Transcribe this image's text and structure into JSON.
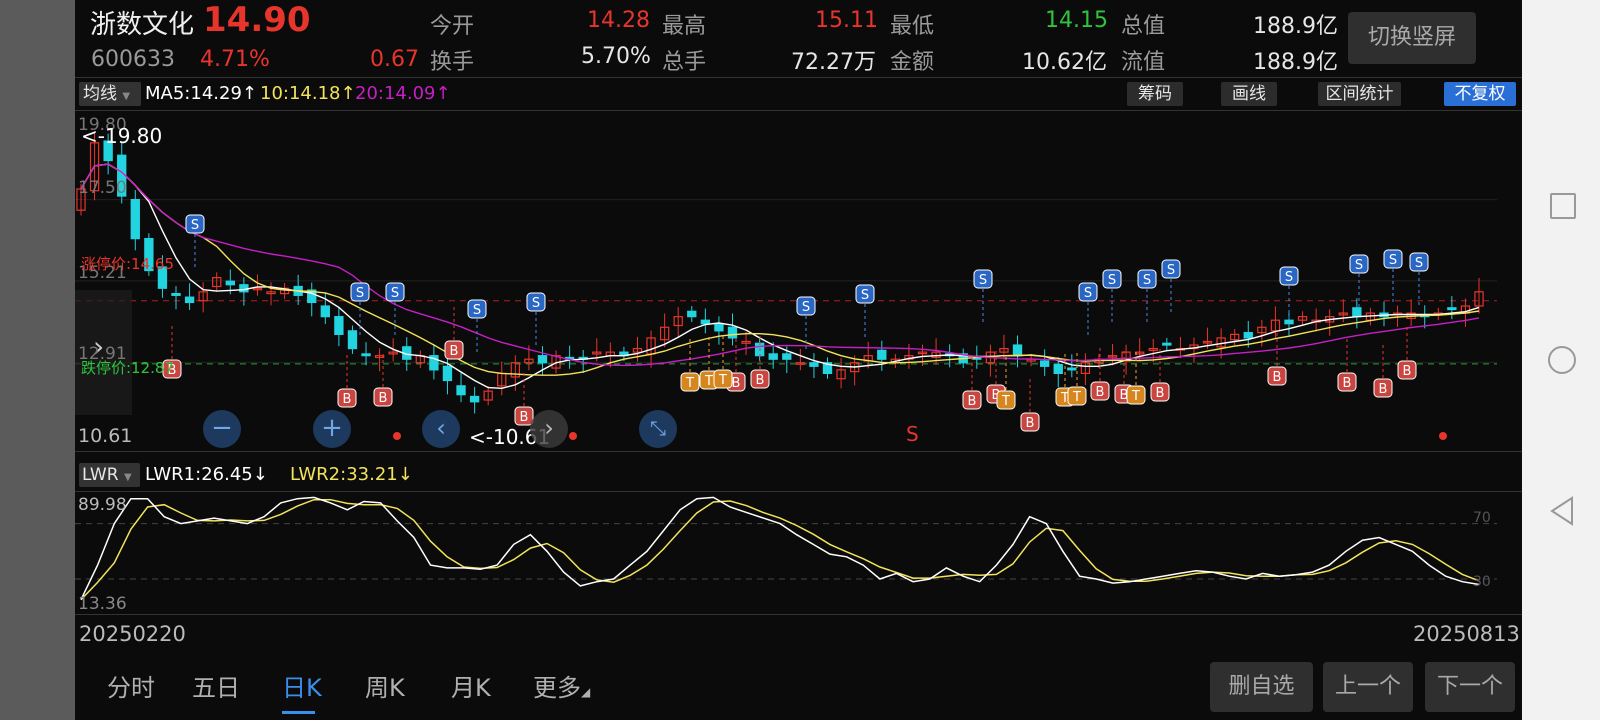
{
  "stock": {
    "name": "浙数文化",
    "price": "14.90",
    "code": "600633",
    "change_pct": "4.71%",
    "change_amt": "0.67"
  },
  "quote": {
    "open_label": "今开",
    "open": "14.28",
    "high_label": "最高",
    "high": "15.11",
    "low_label": "最低",
    "low": "14.15",
    "total_mv_label": "总值",
    "total_mv": "188.9亿",
    "turnover_label": "换手",
    "turnover": "5.70%",
    "volume_label": "总手",
    "volume": "72.27万",
    "amount_label": "金额",
    "amount": "10.62亿",
    "float_mv_label": "流值",
    "float_mv": "188.9亿"
  },
  "switch_button": "切换竖屏",
  "ma_bar": {
    "selector": "均线",
    "ma5": "MA5:14.29↑",
    "ma10": "10:14.18↑",
    "ma20": "20:14.09↑"
  },
  "tools": {
    "chips": "筹码",
    "draw": "画线",
    "range": "区间统计",
    "adjust": "不复权"
  },
  "price_axis": {
    "top": "19.80",
    "l2": "17.50",
    "l3": "15.21",
    "l4": "12.91",
    "bottom": "10.61"
  },
  "annotations": {
    "high_mark": "<-19.80",
    "low_mark": "<-10.61",
    "limit_up": "涨停价:14.65",
    "limit_down": "跌停价:12.87",
    "s_mark": "S"
  },
  "lwr_bar": {
    "selector": "LWR",
    "lwr1": "LWR1:26.45↓",
    "lwr2": "LWR2:33.21↓"
  },
  "lwr_axis": {
    "top": "89.98",
    "bottom": "13.36",
    "r70": "70",
    "r30": "30"
  },
  "dates": {
    "start": "20250220",
    "end": "20250813"
  },
  "tabs": [
    "分时",
    "五日",
    "日K",
    "周K",
    "月K",
    "更多"
  ],
  "active_tab": 2,
  "actions": {
    "remove": "删自选",
    "prev": "上一个",
    "next": "下一个"
  },
  "colors": {
    "up": "#e8352c",
    "down": "#22d3e0",
    "ma5": "#ffffff",
    "ma10": "#f2e35a",
    "ma20": "#c51fc5",
    "active_tab": "#3b8eea"
  },
  "chart_data": {
    "type": "candlestick",
    "ylim": [
      10.61,
      19.8
    ],
    "x_range": [
      "20250220",
      "20250813"
    ],
    "lwr_ylim": [
      13.36,
      89.98
    ],
    "closes": [
      17.8,
      19.1,
      18.6,
      17.6,
      16.4,
      15.5,
      15.0,
      14.8,
      14.6,
      14.9,
      15.3,
      15.1,
      14.9,
      15.0,
      14.9,
      15.0,
      14.8,
      14.6,
      14.2,
      13.7,
      13.3,
      13.1,
      13.1,
      13.2,
      13.0,
      13.1,
      12.7,
      12.4,
      12.0,
      11.8,
      12.1,
      12.6,
      12.9,
      13.0,
      12.9,
      13.1,
      13.0,
      13.0,
      13.2,
      13.2,
      13.1,
      13.3,
      13.6,
      13.9,
      14.2,
      14.2,
      14.0,
      13.8,
      13.6,
      13.5,
      13.1,
      13.0,
      13.0,
      12.9,
      12.8,
      12.6,
      12.7,
      12.9,
      13.1,
      13.0,
      13.0,
      13.1,
      13.2,
      13.2,
      13.1,
      12.9,
      13.0,
      13.2,
      13.3,
      13.1,
      13.0,
      12.8,
      12.6,
      12.7,
      12.9,
      13.0,
      13.1,
      13.2,
      13.2,
      13.3,
      13.4,
      13.3,
      13.4,
      13.5,
      13.6,
      13.7,
      13.6,
      13.9,
      14.1,
      14.0,
      14.2,
      14.1,
      14.2,
      14.3,
      14.2,
      14.3,
      14.2,
      14.3,
      14.3,
      14.2,
      14.3,
      14.4,
      14.5,
      14.9
    ],
    "lwr1": [
      15,
      40,
      70,
      88,
      88,
      75,
      70,
      72,
      74,
      72,
      70,
      75,
      85,
      88,
      89,
      85,
      80,
      86,
      85,
      72,
      60,
      40,
      38,
      38,
      37,
      40,
      55,
      62,
      50,
      35,
      25,
      28,
      30,
      40,
      50,
      65,
      80,
      88,
      89,
      82,
      78,
      74,
      70,
      62,
      55,
      48,
      46,
      40,
      30,
      34,
      28,
      30,
      38,
      32,
      28,
      40,
      55,
      75,
      70,
      50,
      32,
      30,
      27,
      28,
      30,
      32,
      34,
      36,
      35,
      32,
      30,
      34,
      32,
      33,
      35,
      40,
      50,
      58,
      60,
      55,
      50,
      40,
      32,
      28,
      26
    ]
  }
}
